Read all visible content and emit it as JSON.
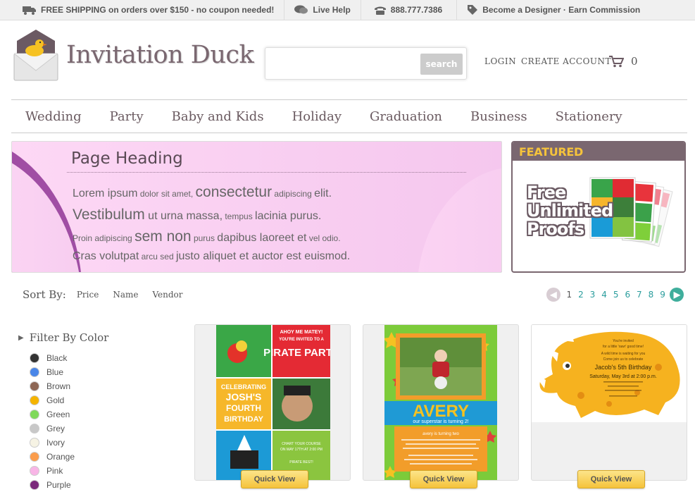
{
  "topbar": {
    "shipping_bold": "FREE SHIPPING",
    "shipping_rest": "on orders over $150 - no coupon needed!",
    "live_help": "Live Help",
    "phone": "888.777.7386",
    "designer": "Become a Designer · Earn Commission"
  },
  "logo": {
    "text": "Invitation Duck"
  },
  "search": {
    "placeholder": "",
    "button": "search"
  },
  "account": {
    "login": "LOGIN",
    "create": "CREATE ACCOUNT",
    "cart_count": "0"
  },
  "nav": [
    "Wedding",
    "Party",
    "Baby and Kids",
    "Holiday",
    "Graduation",
    "Business",
    "Stationery"
  ],
  "hero": {
    "heading": "Page Heading",
    "lines": [
      [
        {
          "t": "Lorem ipsum",
          "s": "m"
        },
        {
          "t": " dolor sit amet, ",
          "s": "s"
        },
        {
          "t": " consectetur",
          "s": "l"
        },
        {
          "t": " adipiscing ",
          "s": "s"
        },
        {
          "t": "elit.",
          "s": "m"
        }
      ],
      [
        {
          "t": "Vestibulum",
          "s": "l"
        },
        {
          "t": " ut urna massa,",
          "s": "m"
        },
        {
          "t": " tempus ",
          "s": "s"
        },
        {
          "t": "lacinia purus.",
          "s": "m"
        }
      ],
      [
        {
          "t": "Proin adipiscing ",
          "s": "s"
        },
        {
          "t": "sem non",
          "s": "l"
        },
        {
          "t": " purus ",
          "s": "s"
        },
        {
          "t": "dapibus laoreet et",
          "s": "m"
        },
        {
          "t": " vel odio.",
          "s": "s"
        }
      ],
      [
        {
          "t": "Cras volutpat",
          "s": "m"
        },
        {
          "t": " arcu sed ",
          "s": "s"
        },
        {
          "t": "justo aliquet et auctor est euismod.",
          "s": "m"
        }
      ]
    ]
  },
  "featured": {
    "label": "FEATURED",
    "line1": "Free",
    "line2": "Unlimited",
    "line3": "Proofs"
  },
  "sort": {
    "label": "Sort By:",
    "options": [
      "Price",
      "Name",
      "Vendor"
    ]
  },
  "pager": {
    "pages": [
      "1",
      "2",
      "3",
      "4",
      "5",
      "6",
      "7",
      "8",
      "9"
    ],
    "current": "1"
  },
  "filter": {
    "title": "Filter By Color",
    "colors": [
      {
        "name": "Black",
        "hex": "#333333"
      },
      {
        "name": "Blue",
        "hex": "#4a86e8"
      },
      {
        "name": "Brown",
        "hex": "#8d6654"
      },
      {
        "name": "Gold",
        "hex": "#f5b400"
      },
      {
        "name": "Green",
        "hex": "#7fd95a"
      },
      {
        "name": "Grey",
        "hex": "#c8c8c8"
      },
      {
        "name": "Ivory",
        "hex": "#f6f3e4"
      },
      {
        "name": "Orange",
        "hex": "#fb9d4c"
      },
      {
        "name": "Pink",
        "hex": "#f8b5e6"
      },
      {
        "name": "Purple",
        "hex": "#7b2a7b"
      }
    ]
  },
  "products": [
    {
      "texts": [
        "AHOY ME MATEY!",
        "YOU'RE INVITED TO A",
        "PIRATE PARTY",
        "CELEBRATING",
        "JOSH'S",
        "FOURTH",
        "BIRTHDAY",
        "CHART YOUR COURSE",
        "ON MAY 17TH AT 2:00 PM",
        "PIRATE BEST!"
      ],
      "button": "Quick View"
    },
    {
      "texts": [
        "AVERY",
        "our superstar is turning 2!",
        "avery is turning two"
      ],
      "button": "Quick View"
    },
    {
      "texts": [
        "You're invited",
        "for a little 'rawr' good time!",
        "A wild time is waiting for you",
        "Come join us to celebrate",
        "Jacob's 5th Birthday",
        "Saturday, May 3rd at 2:00 p.m."
      ],
      "button": "Quick View"
    }
  ]
}
